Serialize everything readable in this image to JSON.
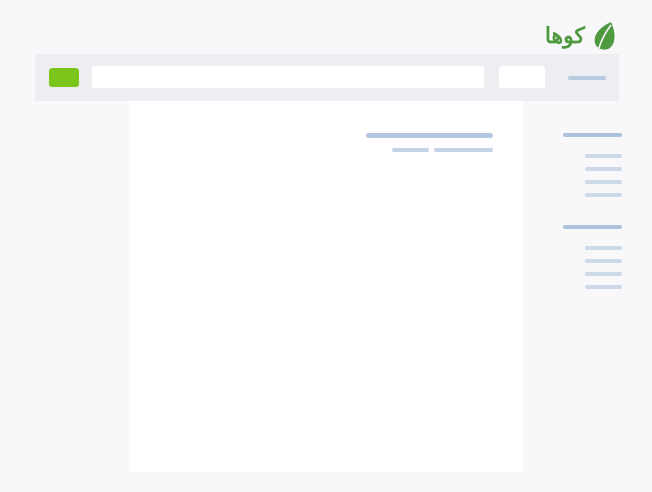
{
  "logo": {
    "text": "كوها",
    "color": "#4f9a3e"
  },
  "topbar": {
    "go_button_color": "#7cc51a",
    "search_value": "",
    "search_placeholder": ""
  },
  "content": {
    "heading": "",
    "subheading_parts": [
      "",
      ""
    ]
  },
  "sidebar": {
    "sections": [
      {
        "title": "",
        "items": [
          "",
          "",
          "",
          ""
        ]
      },
      {
        "title": "",
        "items": [
          "",
          "",
          "",
          ""
        ]
      }
    ]
  },
  "colors": {
    "page_bg": "#f8f8fa",
    "topbar_bg": "#eceef1",
    "placeholder_bar": "#b2c6dd"
  }
}
